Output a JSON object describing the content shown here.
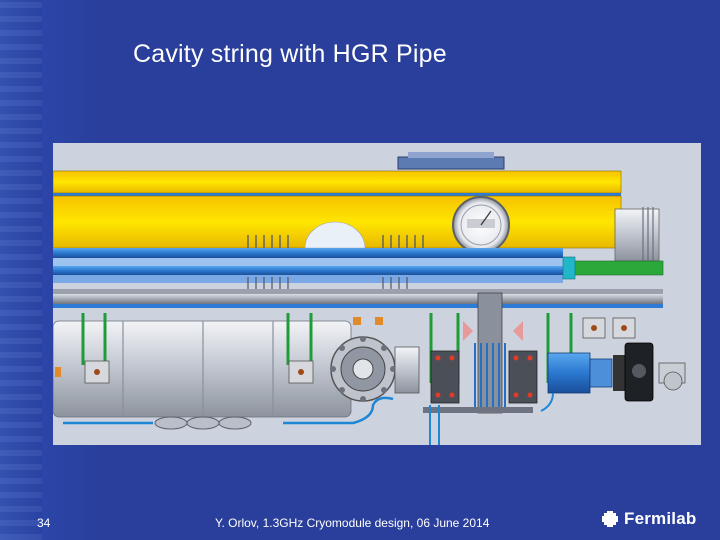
{
  "slide": {
    "title": "Cavity string with HGR Pipe",
    "number": "34",
    "footer": "Y. Orlov, 1.3GHz Cryomodule design, 06 June 2014",
    "logo": "Fermilab"
  },
  "figure": {
    "subject": "cavity-string-cad-assembly"
  },
  "colors": {
    "background": "#2a3f9b",
    "text": "#ffffff",
    "hgr_pipe": "#ffe400",
    "pipe_blue": "#2e7bd6"
  }
}
